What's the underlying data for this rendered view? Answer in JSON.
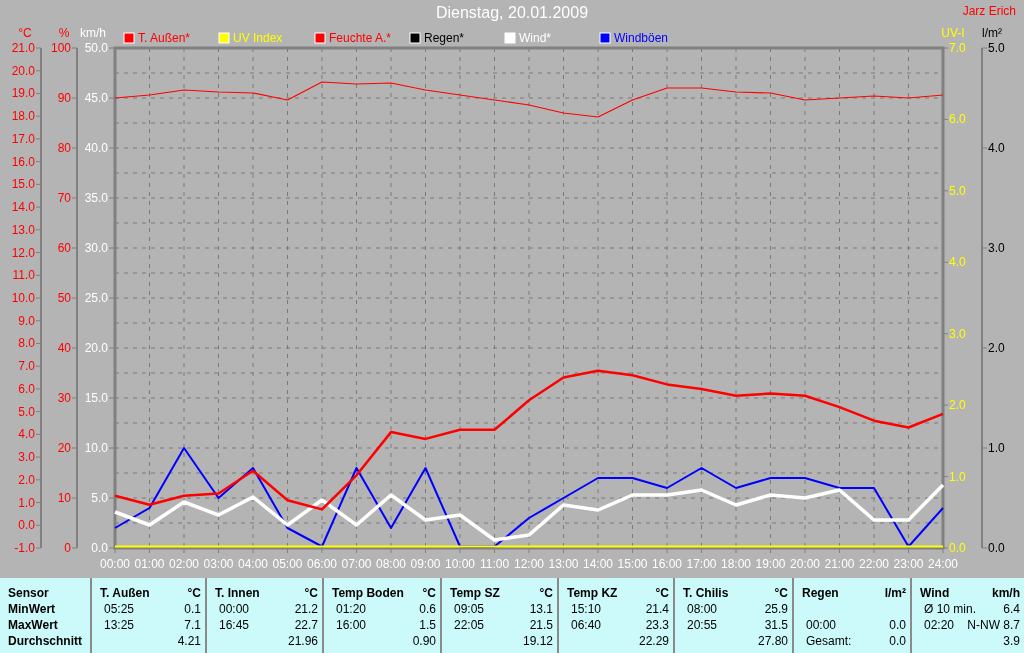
{
  "title": "Dienstag, 20.01.2009",
  "author": "Jarz Erich",
  "chart": {
    "chart_data": {
      "type": "line",
      "legend": "top",
      "grid": true,
      "categories": [
        "00:00",
        "01:00",
        "02:00",
        "03:00",
        "04:00",
        "05:00",
        "06:00",
        "07:00",
        "08:00",
        "09:00",
        "10:00",
        "11:00",
        "12:00",
        "13:00",
        "14:00",
        "15:00",
        "16:00",
        "17:00",
        "18:00",
        "19:00",
        "20:00",
        "21:00",
        "22:00",
        "23:00",
        "24:00"
      ],
      "ylabel": "km/h",
      "ylim": [
        0,
        50
      ],
      "yticks": [
        {
          "value": 0,
          "label": "0.0"
        },
        {
          "value": 5,
          "label": "5.0"
        },
        {
          "value": 10,
          "label": "10.0"
        },
        {
          "value": 15,
          "label": "15.0"
        },
        {
          "value": 20,
          "label": "20.0"
        },
        {
          "value": 25,
          "label": "25.0"
        },
        {
          "value": 30,
          "label": "30.0"
        },
        {
          "value": 35,
          "label": "35.0"
        },
        {
          "value": 40,
          "label": "40.0"
        },
        {
          "value": 45,
          "label": "45.0"
        },
        {
          "value": 50,
          "label": "50.0"
        }
      ],
      "y2label": "°C",
      "y2lim": [
        -1,
        21
      ],
      "y2ticks": [
        {
          "value": -1,
          "label": "-1.0"
        },
        {
          "value": 0,
          "label": "0.0"
        },
        {
          "value": 1,
          "label": "1.0"
        },
        {
          "value": 2,
          "label": "2.0"
        },
        {
          "value": 3,
          "label": "3.0"
        },
        {
          "value": 4,
          "label": "4.0"
        },
        {
          "value": 5,
          "label": "5.0"
        },
        {
          "value": 6,
          "label": "6.0"
        },
        {
          "value": 7,
          "label": "7.0"
        },
        {
          "value": 8,
          "label": "8.0"
        },
        {
          "value": 9,
          "label": "9.0"
        },
        {
          "value": 10,
          "label": "10.0"
        },
        {
          "value": 11,
          "label": "11.0"
        },
        {
          "value": 12,
          "label": "12.0"
        },
        {
          "value": 13,
          "label": "13.0"
        },
        {
          "value": 14,
          "label": "14.0"
        },
        {
          "value": 15,
          "label": "15.0"
        },
        {
          "value": 16,
          "label": "16.0"
        },
        {
          "value": 17,
          "label": "17.0"
        },
        {
          "value": 18,
          "label": "18.0"
        },
        {
          "value": 19,
          "label": "19.0"
        },
        {
          "value": 20,
          "label": "20.0"
        },
        {
          "value": 21,
          "label": "21.0"
        }
      ],
      "y3label": "%",
      "y3lim": [
        0,
        100
      ],
      "y3ticks": [
        0,
        10,
        20,
        30,
        40,
        50,
        60,
        70,
        80,
        90,
        100
      ],
      "series": [
        {
          "name": "T. Außen*",
          "color": "#ff0000",
          "axis": "y2",
          "values": [
            1.3,
            0.9,
            1.3,
            1.4,
            2.4,
            1.1,
            0.7,
            2.2,
            4.1,
            3.8,
            4.2,
            4.2,
            5.5,
            6.5,
            6.8,
            6.6,
            6.2,
            6.0,
            5.7,
            5.8,
            5.7,
            5.2,
            4.6,
            4.3,
            4.9
          ]
        },
        {
          "name": "UV Index",
          "color": "#ffff00",
          "values": [
            0,
            0,
            0,
            0,
            0,
            0,
            0,
            0,
            0,
            0,
            0,
            0,
            0,
            0,
            0,
            0,
            0,
            0,
            0,
            0,
            0,
            0,
            0,
            0,
            0
          ]
        },
        {
          "name": "Feuchte A.*",
          "color": "#ff0000",
          "axis": "y3",
          "values": [
            90,
            90.6,
            91.6,
            91.2,
            91,
            89.6,
            93.2,
            92.8,
            93,
            91.6,
            90.6,
            89.6,
            88.6,
            87,
            86.2,
            89.6,
            92,
            92,
            91.2,
            91,
            89.6,
            90,
            90.4,
            90,
            90.6
          ]
        },
        {
          "name": "Regen*",
          "color": "#000000",
          "values": [
            null,
            null,
            null,
            null,
            null,
            null,
            null,
            null,
            null,
            null,
            null,
            null,
            null,
            null,
            null,
            null,
            null,
            null,
            null,
            null,
            null,
            null,
            null,
            null,
            null
          ]
        },
        {
          "name": "Wind*",
          "color": "#ffffff",
          "values": [
            3.6,
            2.3,
            4.6,
            3.3,
            5.1,
            2.3,
            4.8,
            2.3,
            5.3,
            2.8,
            3.3,
            0.8,
            1.3,
            4.3,
            3.8,
            5.3,
            5.3,
            5.8,
            4.3,
            5.3,
            5.0,
            5.8,
            2.8,
            2.8,
            6.3
          ]
        },
        {
          "name": "Windböen",
          "color": "#0000ff",
          "values": [
            2,
            4,
            10,
            5,
            8,
            2,
            0,
            8,
            2,
            8,
            0,
            0,
            3,
            5,
            7,
            7,
            6,
            8,
            6,
            7,
            7,
            6,
            6,
            0,
            4
          ]
        }
      ]
    },
    "right_axes": [
      {
        "unit": "UV-I",
        "labels": [
          "7.0",
          "6.0",
          "5.0",
          "4.0",
          "3.0",
          "2.0",
          "1.0",
          "0.0"
        ]
      },
      {
        "unit": "l/m²",
        "labels": [
          "5.0",
          "4.0",
          "3.0",
          "2.0",
          "1.0",
          "0.0"
        ]
      }
    ]
  },
  "table": {
    "header": "Sensor",
    "row_labels": [
      "MinWert",
      "MaxWert",
      "Durchschnitt"
    ],
    "sensors": [
      {
        "name": "T. Außen",
        "unit": "°C",
        "rows": [
          {
            "time": "05:25",
            "value": "0.1"
          },
          {
            "time": "13:25",
            "value": "7.1"
          },
          {
            "value": "4.21"
          }
        ]
      },
      {
        "name": "T. Innen",
        "unit": "°C",
        "rows": [
          {
            "time": "00:00",
            "value": "21.2"
          },
          {
            "time": "16:45",
            "value": "22.7"
          },
          {
            "value": "21.96"
          }
        ]
      },
      {
        "name": "Temp Boden",
        "unit": "°C",
        "rows": [
          {
            "time": "01:20",
            "value": "0.6"
          },
          {
            "time": "16:00",
            "value": "1.5"
          },
          {
            "value": "0.90"
          }
        ]
      },
      {
        "name": "Temp SZ",
        "unit": "°C",
        "rows": [
          {
            "time": "09:05",
            "value": "13.1"
          },
          {
            "time": "22:05",
            "value": "21.5"
          },
          {
            "value": "19.12"
          }
        ]
      },
      {
        "name": "Temp KZ",
        "unit": "°C",
        "rows": [
          {
            "time": "15:10",
            "value": "21.4"
          },
          {
            "time": "06:40",
            "value": "23.3"
          },
          {
            "value": "22.29"
          }
        ]
      },
      {
        "name": "T. Chilis",
        "unit": "°C",
        "rows": [
          {
            "time": "08:00",
            "value": "25.9"
          },
          {
            "time": "20:55",
            "value": "31.5"
          },
          {
            "value": "27.80"
          }
        ]
      },
      {
        "name": "Regen",
        "unit": "l/m²",
        "rows": [
          {},
          {
            "time": "00:00",
            "value": "0.0"
          },
          {
            "time": "Gesamt:",
            "value": "0.0"
          }
        ]
      },
      {
        "name": "Wind",
        "unit": "km/h",
        "rows": [
          {
            "time": "Ø 10 min.",
            "value": "6.4"
          },
          {
            "time": "02:20",
            "value": "N-NW 8.7"
          },
          {
            "value": "3.9"
          }
        ]
      }
    ]
  }
}
